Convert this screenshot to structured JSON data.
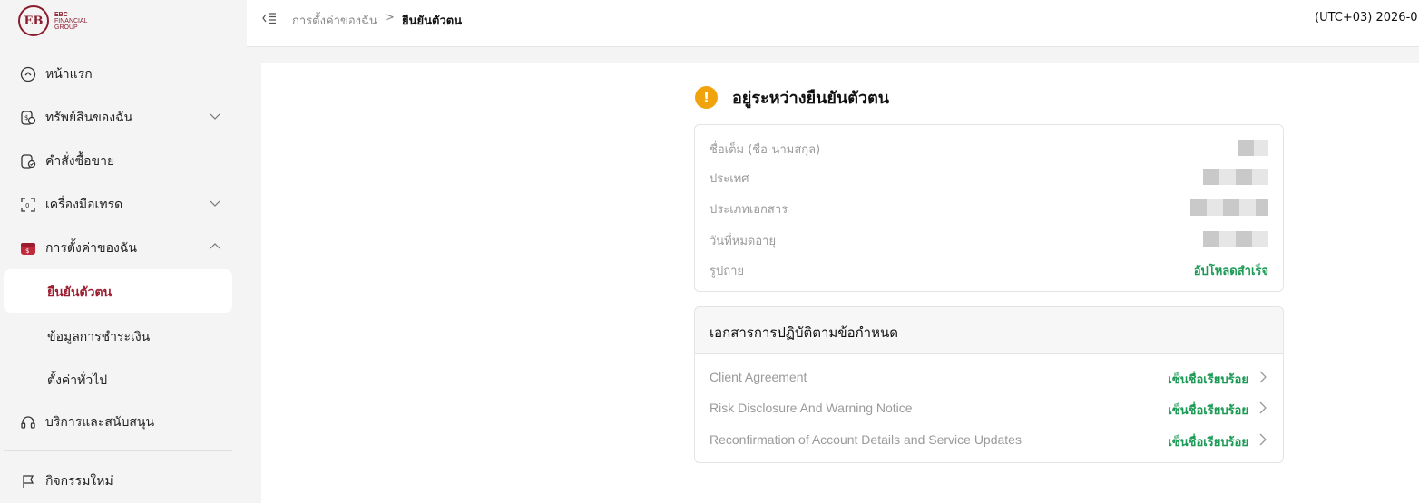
{
  "brand": {
    "mark": "EB",
    "line1": "EBC",
    "line2": "FINANCIAL",
    "line3": "GROUP",
    "color": "#8b1d2c"
  },
  "sidebar": {
    "items": [
      {
        "label": "หน้าแรก",
        "icon": "home-icon"
      },
      {
        "label": "ทรัพย์สินของฉัน",
        "icon": "assets-icon",
        "expandable": true
      },
      {
        "label": "คำสั่งซื้อขาย",
        "icon": "orders-icon"
      },
      {
        "label": "เครื่องมือเทรด",
        "icon": "tools-icon",
        "expandable": true
      },
      {
        "label": "การตั้งค่าของฉัน",
        "icon": "settings-wallet-icon",
        "expanded": true
      },
      {
        "label": "บริการและสนับสนุน",
        "icon": "headset-icon"
      },
      {
        "label": "กิจกรรมใหม่",
        "icon": "flag-icon"
      }
    ],
    "subitems": [
      {
        "label": "ยืนยันตัวตน",
        "active": true
      },
      {
        "label": "ข้อมูลการชำระเงิน"
      },
      {
        "label": "ตั้งค่าทั่วไป"
      }
    ]
  },
  "header": {
    "breadcrumb_parent": "การตั้งค่าของฉัน",
    "breadcrumb_sep": ">",
    "breadcrumb_current": "ยืนยันตัวตน",
    "timezone": "(UTC+03)  2026-0"
  },
  "verification": {
    "status_title": "อยู่ระหว่างยืนยันตัวตน",
    "fields": [
      {
        "label": "ชื่อเต็ม (ชื่อ-นามสกุล)"
      },
      {
        "label": "ประเทศ"
      },
      {
        "label": "ประเภทเอกสาร"
      },
      {
        "label": "วันที่หมดอายุ"
      },
      {
        "label": "รูปถ่าย",
        "value": "อัปโหลดสำเร็จ"
      }
    ]
  },
  "compliance": {
    "title": "เอกสารการปฏิบัติตามข้อกำหนด",
    "docs": [
      {
        "name": "Client Agreement",
        "status": "เซ็นชื่อเรียบร้อย"
      },
      {
        "name": "Risk Disclosure And Warning Notice",
        "status": "เซ็นชื่อเรียบร้อย"
      },
      {
        "name": "Reconfirmation of Account Details and Service Updates",
        "status": "เซ็นชื่อเรียบร้อย"
      }
    ]
  },
  "colors": {
    "accent": "#9b1c2e",
    "success": "#1a9a54",
    "warning": "#f0a30a"
  }
}
